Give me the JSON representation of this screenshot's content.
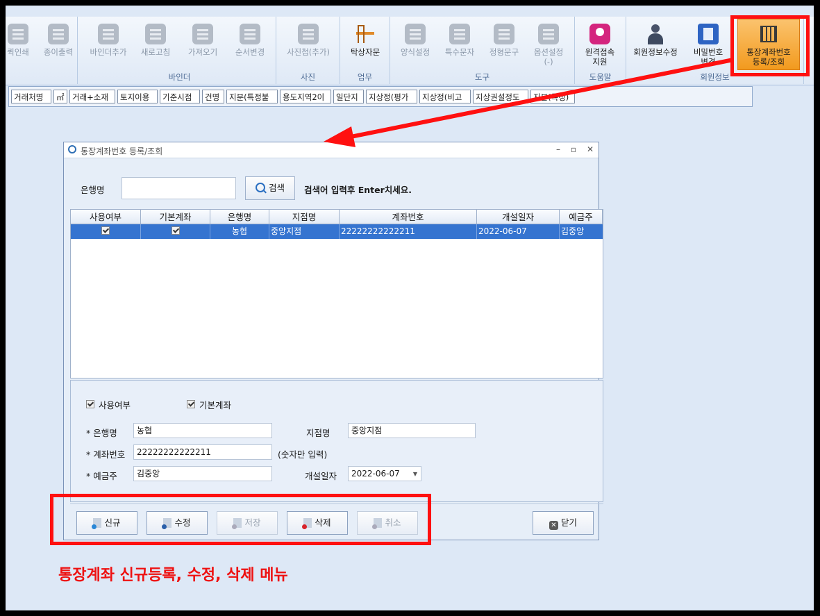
{
  "ribbon": {
    "groups": [
      {
        "label": "",
        "buttons": [
          "퀵인쇄",
          "종이출력"
        ]
      },
      {
        "label": "바인더",
        "buttons": [
          "바인더추가",
          "새로고침",
          "가져오기",
          "순서변경"
        ]
      },
      {
        "label": "사진",
        "buttons": [
          "사진첩(추가)"
        ]
      },
      {
        "label": "업무",
        "buttons": [
          "탁상자문"
        ]
      },
      {
        "label": "도구",
        "buttons": [
          "양식설정",
          "특수문자",
          "정형문구",
          "옵션설정\n(-)"
        ]
      },
      {
        "label": "도움말",
        "buttons": [
          "원격접속\n지원"
        ]
      },
      {
        "label": "회원정보",
        "buttons": [
          "회원정보수정",
          "비밀번호\n변경",
          "통장계좌번호\n등록/조회"
        ]
      }
    ]
  },
  "tags": [
    "거래처명",
    "㎡",
    "거래+소재",
    "토지이용",
    "기준시점",
    "건명",
    "지분(특정불",
    "용도지역2이",
    "일단지",
    "지상정(평가",
    "지상정(비고",
    "지상권설정도",
    "지분(특정)"
  ],
  "dialog": {
    "title": "통장계좌번호 등록/조회",
    "search": {
      "label": "은행명",
      "value": "",
      "button": "검색",
      "hint": "검색어 입력후 Enter치세요."
    },
    "columns": [
      "사용여부",
      "기본계좌",
      "은행명",
      "지점명",
      "계좌번호",
      "개설일자",
      "예금주"
    ],
    "rows": [
      {
        "use": true,
        "default": true,
        "bank": "농협",
        "branch": "중앙지점",
        "account": "22222222222211",
        "opened": "2022-06-07",
        "holder": "김중앙"
      }
    ],
    "form": {
      "use_label": "사용여부",
      "use_checked": true,
      "default_label": "기본계좌",
      "default_checked": true,
      "bank_label": "* 은행명",
      "bank_value": "농협",
      "branch_label": "지점명",
      "branch_value": "중앙지점",
      "account_label": "* 계좌번호",
      "account_value": "22222222222211",
      "account_note": "(숫자만 입력)",
      "holder_label": "* 예금주",
      "holder_value": "김중앙",
      "opened_label": "개설일자",
      "opened_value": "2022-06-07"
    },
    "actions": {
      "new": "신규",
      "edit": "수정",
      "save": "저장",
      "delete": "삭제",
      "cancel": "취소",
      "close": "닫기"
    }
  },
  "caption": "통장계좌 신규등록, 수정, 삭제 메뉴",
  "colors": {
    "highlight": "#ff1010",
    "selection": "#3574d0",
    "ribbon_active": "#f29a1e"
  }
}
